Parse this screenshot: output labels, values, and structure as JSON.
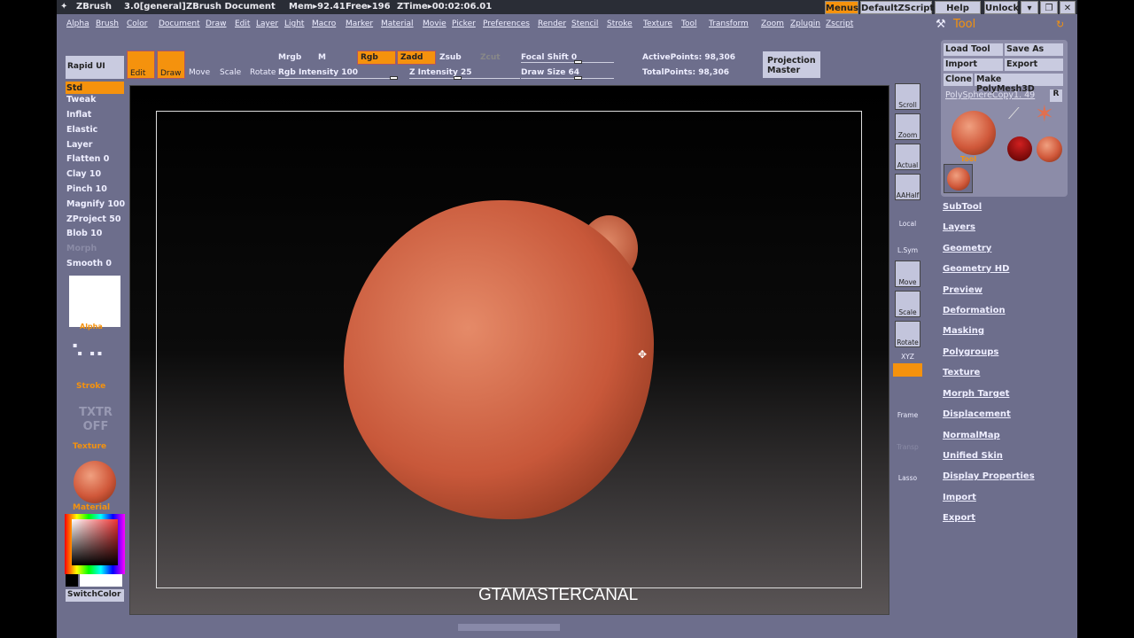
{
  "titlebar": {
    "app": "ZBrush",
    "version": "3.0[general]",
    "document": "ZBrush Document",
    "mem": "Mem▸92.41",
    "free": "Free▸196",
    "ztime": "ZTime▸00:02:06.01",
    "buttons": [
      "Menus",
      "DefaultZScript",
      "Help",
      "Unlock"
    ]
  },
  "menus": [
    "Alpha",
    "Brush",
    "Color",
    "Document",
    "Draw",
    "Edit",
    "Layer",
    "Light",
    "Macro",
    "Marker",
    "Material",
    "Movie",
    "Picker",
    "Preferences",
    "Render",
    "Stencil",
    "Stroke",
    "Texture",
    "Tool",
    "Transform",
    "Zoom",
    "Zplugin",
    "Zscript"
  ],
  "toolbar": {
    "rapid_ui": "Rapid UI",
    "edit": "Edit",
    "draw": "Draw",
    "move": "Move",
    "scale": "Scale",
    "rotate": "Rotate",
    "mrgb": "Mrgb",
    "m": "M",
    "rgb": "Rgb",
    "zadd": "Zadd",
    "zsub": "Zsub",
    "zcut": "Zcut",
    "rgb_intensity": "Rgb Intensity 100",
    "z_intensity": "Z Intensity 25",
    "focal_shift": "Focal Shift 0",
    "draw_size": "Draw Size 64",
    "active_points": "ActivePoints: 98,306",
    "total_points": "TotalPoints: 98,306",
    "projection_master": "Projection Master",
    "sliders": {
      "rgb_intensity": 100,
      "z_intensity": 25,
      "focal_shift": 0,
      "draw_size": 64
    }
  },
  "brushes": [
    "Std",
    "Tweak",
    "Inflat",
    "Elastic",
    "Layer",
    "Flatten 0",
    "Clay 10",
    "Pinch 10",
    "Magnify 100",
    "ZProject 50",
    "Blob 10",
    "Morph",
    "Smooth 0"
  ],
  "left": {
    "alpha": "Alpha",
    "stroke": "Stroke",
    "texture_off": "TXTR OFF",
    "texture": "Texture",
    "material": "Material",
    "switch_color": "SwitchColor"
  },
  "right_tools": [
    "Scroll",
    "Zoom",
    "Actual",
    "AAHalf",
    "Local",
    "L.Sym",
    "Move",
    "Scale",
    "Rotate",
    "XYZ",
    "Frame",
    "Transp",
    "Lasso"
  ],
  "tool_panel": {
    "title": "Tool",
    "load_tool": "Load Tool",
    "save_as": "Save As",
    "import": "Import",
    "export": "Export",
    "clone": "Clone",
    "make_polymesh": "Make PolyMesh3D",
    "current_tool": "PolySphereCopy1. 49",
    "r": "R",
    "tool_label": "Tool"
  },
  "sections": [
    "SubTool",
    "Layers",
    "Geometry",
    "Geometry HD",
    "Preview",
    "Deformation",
    "Masking",
    "Polygroups",
    "Texture",
    "Morph Target",
    "Displacement",
    "NormalMap",
    "Unified Skin",
    "Display Properties",
    "Import",
    "Export"
  ],
  "watermark": "GTAMASTERCANAL",
  "colors": {
    "accent": "#f5920d",
    "ui_bg": "#6d6e8c",
    "model": "#c8583a"
  }
}
